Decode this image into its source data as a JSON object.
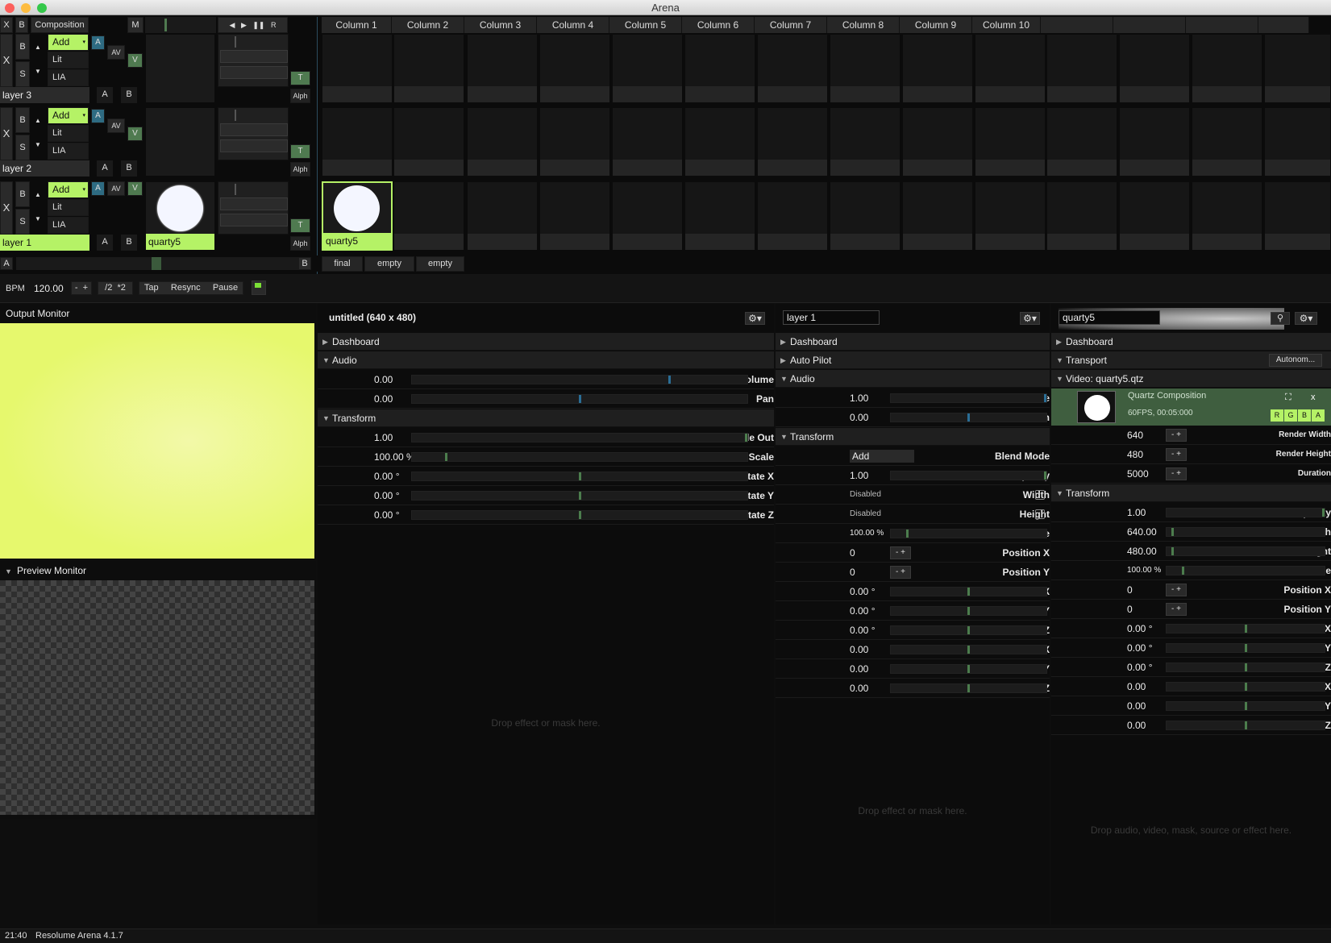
{
  "app": {
    "title": "Arena",
    "status": "Resolume Arena 4.1.7",
    "time": "21:40"
  },
  "topbar": {
    "x": "X",
    "b": "B",
    "composition": "Composition",
    "m": "M",
    "prev": "◀",
    "next": "▶",
    "pause": "❚❚",
    "r": "R"
  },
  "columns": [
    "Column 1",
    "Column 2",
    "Column 3",
    "Column 4",
    "Column 5",
    "Column 6",
    "Column 7",
    "Column 8",
    "Column 9",
    "Column 10"
  ],
  "layers": [
    {
      "name": "layer 3",
      "blend": "Add",
      "mode2": "Lit",
      "mode3": "LIA",
      "clip_label": ""
    },
    {
      "name": "layer 2",
      "blend": "Add",
      "mode2": "Lit",
      "mode3": "LIA",
      "clip_label": ""
    },
    {
      "name": "layer 1",
      "blend": "Add",
      "mode2": "Lit",
      "mode3": "LIA",
      "clip_label": "quarty5"
    }
  ],
  "layer_controls": {
    "x": "X",
    "b": "B",
    "s": "S",
    "up": "▲",
    "down": "▼",
    "a": "A",
    "av": "AV",
    "v": "V",
    "t": "T",
    "alph": "Alph",
    "ab_a": "A",
    "ab_b": "B"
  },
  "clip_cells": {
    "col1_layer1": "quarty5"
  },
  "crossfader": {
    "a": "A",
    "b": "B"
  },
  "decks": [
    "final",
    "empty",
    "empty"
  ],
  "bpm": {
    "label": "BPM",
    "value": "120.00",
    "minus": "-",
    "plus": "+",
    "half": "/2",
    "double": "*2",
    "tap": "Tap",
    "resync": "Resync",
    "pause": "Pause"
  },
  "output_monitor": {
    "title": "Output Monitor",
    "color": "#e6f86d"
  },
  "preview_monitor": {
    "title": "Preview Monitor"
  },
  "comp_panel": {
    "title": "untitled (640 x 480)",
    "sections": {
      "dashboard": "Dashboard",
      "audio": "Audio",
      "transform": "Transform"
    },
    "audio": [
      {
        "label": "Volume",
        "value": "0.00",
        "level": 0.77
      },
      {
        "label": "Pan",
        "value": "0.00",
        "level": 0.5
      }
    ],
    "transform": [
      {
        "label": "Fade Out",
        "value": "1.00",
        "level": 1.0
      },
      {
        "label": "Scale",
        "value": "100.00 %",
        "level": 0.1
      },
      {
        "label": "Rotate X",
        "value": "0.00 °",
        "level": 0.5
      },
      {
        "label": "Rotate Y",
        "value": "0.00 °",
        "level": 0.5
      },
      {
        "label": "Rotate Z",
        "value": "0.00 °",
        "level": 0.5
      }
    ],
    "drop": "Drop effect or mask here."
  },
  "layer_panel": {
    "name": "layer 1",
    "sections": {
      "dashboard": "Dashboard",
      "autopilot": "Auto Pilot",
      "audio": "Audio",
      "transform": "Transform"
    },
    "audio": [
      {
        "label": "Volume",
        "value": "1.00",
        "level": 1.0
      },
      {
        "label": "Pan",
        "value": "0.00",
        "level": 0.5
      }
    ],
    "blend_label": "Blend Mode",
    "blend_value": "Add",
    "opacity": {
      "label": "Opacity",
      "value": "1.00",
      "level": 1.0
    },
    "width": {
      "label": "Width",
      "value": "Disabled"
    },
    "height": {
      "label": "Height",
      "value": "Disabled"
    },
    "scale": {
      "label": "Scale",
      "value": "100.00 %",
      "level": 0.1
    },
    "posx": {
      "label": "Position X",
      "value": "0"
    },
    "posy": {
      "label": "Position Y",
      "value": "0"
    },
    "rest": [
      {
        "label": "Rotate X",
        "value": "0.00 °",
        "level": 0.5
      },
      {
        "label": "Rotate Y",
        "value": "0.00 °",
        "level": 0.5
      },
      {
        "label": "Rotate Z",
        "value": "0.00 °",
        "level": 0.5
      },
      {
        "label": "Anchor X",
        "value": "0.00",
        "level": 0.5
      },
      {
        "label": "Anchor Y",
        "value": "0.00",
        "level": 0.5
      },
      {
        "label": "Anchor Z",
        "value": "0.00",
        "level": 0.5
      }
    ],
    "drop": "Drop effect or mask here."
  },
  "clip_panel": {
    "name": "quarty5",
    "sections": {
      "dashboard": "Dashboard",
      "transport": "Transport",
      "video": "Video: quarty5.qtz",
      "transform": "Transform"
    },
    "transport_mode": "Autonom...",
    "source_type": "Quartz Composition",
    "source_info": "60FPS, 00:05:000",
    "rgba": [
      "R",
      "G",
      "B",
      "A"
    ],
    "render": [
      {
        "label": "Render Width",
        "value": "640"
      },
      {
        "label": "Render Height",
        "value": "480"
      },
      {
        "label": "Duration",
        "value": "5000"
      }
    ],
    "opacity": {
      "label": "Opacity",
      "value": "1.00",
      "level": 1.0
    },
    "width": {
      "label": "Width",
      "value": "640.00",
      "level": 0.03
    },
    "height": {
      "label": "Height",
      "value": "480.00",
      "level": 0.03
    },
    "scale": {
      "label": "Scale",
      "value": "100.00 %",
      "level": 0.1
    },
    "posx": {
      "label": "Position X",
      "value": "0"
    },
    "posy": {
      "label": "Position Y",
      "value": "0"
    },
    "rest": [
      {
        "label": "Rotate X",
        "value": "0.00 °",
        "level": 0.5
      },
      {
        "label": "Rotate Y",
        "value": "0.00 °",
        "level": 0.5
      },
      {
        "label": "Rotate Z",
        "value": "0.00 °",
        "level": 0.5
      },
      {
        "label": "Anchor X",
        "value": "0.00",
        "level": 0.5
      },
      {
        "label": "Anchor Y",
        "value": "0.00",
        "level": 0.5
      },
      {
        "label": "Anchor Z",
        "value": "0.00",
        "level": 0.5
      }
    ],
    "drop": "Drop audio, video, mask, source or effect here."
  }
}
